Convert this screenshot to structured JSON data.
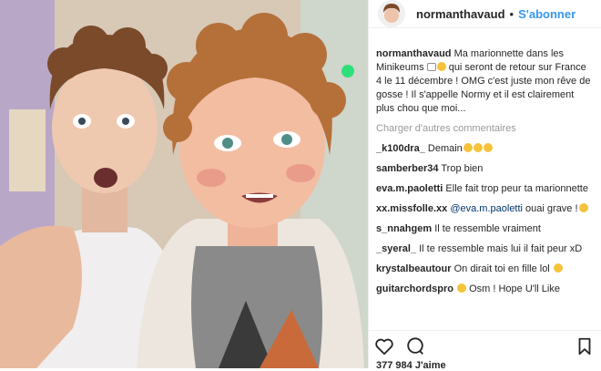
{
  "header": {
    "username": "normanthavaud",
    "separator": "•",
    "follow_label": "S'abonner"
  },
  "caption": {
    "username": "normanthavaud",
    "text_part1": "Ma marionnette dans les Minikeums",
    "text_part2": " qui seront de retour sur France 4 le 11 décembre ! OMG c'est juste mon rêve de gosse ! Il s'appelle Normy et il est clairement plus chou que moi..."
  },
  "load_more": "Charger d'autres commentaires",
  "comments": [
    {
      "user": "_k100dra_",
      "text": "Demain",
      "emojis": 3
    },
    {
      "user": "samberber34",
      "text": "Trop bien",
      "emojis": 0
    },
    {
      "user": "eva.m.paoletti",
      "text": "Elle fait trop peur ta marionnette",
      "emojis": 0
    },
    {
      "user": "xx.missfolle.xx",
      "mention": "@eva.m.paoletti",
      "text": " ouai grave !",
      "emojis": 1
    },
    {
      "user": "s_nnahgem",
      "text": "Il te ressemble vraiment",
      "emojis": 0
    },
    {
      "user": "_syeral_",
      "text": "Il te ressemble mais lui il fait peur xD",
      "emojis": 0
    },
    {
      "user": "krystalbeautour",
      "text": "On dirait toi en fille lol",
      "emojis": 1
    },
    {
      "user": "guitarchordspro",
      "text": "Osm ! Hope U'll Like",
      "emojis": 1,
      "emoji_first": true
    }
  ],
  "likes": {
    "count": "377 984",
    "label": "J'aime"
  },
  "icons": {
    "like": "heart-icon",
    "comment": "comment-icon",
    "save": "bookmark-icon"
  },
  "colors": {
    "follow": "#3897f0",
    "muted": "#999999",
    "mention": "#003569"
  }
}
